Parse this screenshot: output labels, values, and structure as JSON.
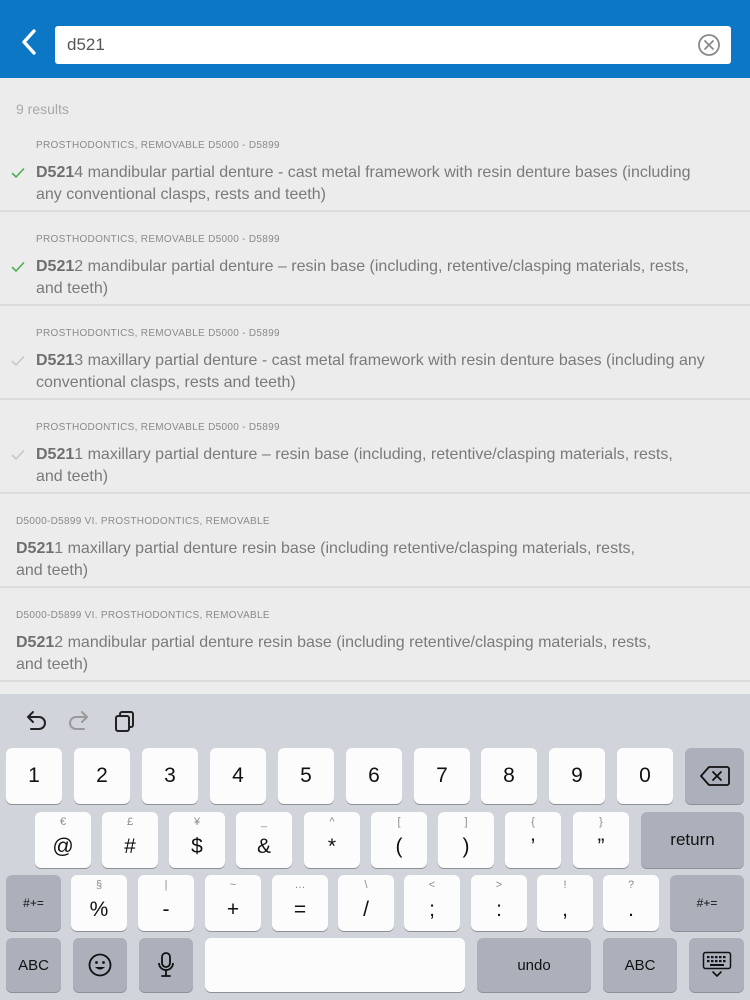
{
  "search": {
    "query": "d521",
    "placeholder": ""
  },
  "results_count": "9 results",
  "results": [
    {
      "category": "PROSTHODONTICS, REMOVABLE D5000 - D5899",
      "code_match": "D521",
      "code_rest": "4",
      "line1": " mandibular partial denture - cast metal framework with resin denture bases (including",
      "line2": "any conventional clasps, rests and teeth)",
      "checked": true,
      "check_color": "#4caf50"
    },
    {
      "category": "PROSTHODONTICS, REMOVABLE D5000 - D5899",
      "code_match": "D521",
      "code_rest": "2",
      "line1": " mandibular partial denture – resin base (including, retentive/clasping materials, rests,",
      "line2": "and teeth)",
      "checked": true,
      "check_color": "#4caf50"
    },
    {
      "category": "PROSTHODONTICS, REMOVABLE D5000 - D5899",
      "code_match": "D521",
      "code_rest": "3",
      "line1": " maxillary partial denture - cast metal framework with resin denture bases (including any",
      "line2": "conventional clasps, rests and teeth)",
      "checked": true,
      "check_color": "#c8c8c8"
    },
    {
      "category": "PROSTHODONTICS, REMOVABLE D5000 - D5899",
      "code_match": "D521",
      "code_rest": "1",
      "line1": " maxillary partial denture – resin base (including, retentive/clasping materials, rests,",
      "line2": "and teeth)",
      "checked": true,
      "check_color": "#c8c8c8"
    },
    {
      "category": "D5000-D5899 VI. PROSTHODONTICS, REMOVABLE",
      "code_match": "D521",
      "code_rest": "1",
      "line1": " maxillary partial denture resin base (including retentive/clasping materials, rests,",
      "line2": "and teeth)",
      "checked": false
    },
    {
      "category": "D5000-D5899 VI. PROSTHODONTICS, REMOVABLE",
      "code_match": "D521",
      "code_rest": "2",
      "line1": " mandibular partial denture resin base (including retentive/clasping materials, rests,",
      "line2": "and teeth)",
      "checked": false
    }
  ],
  "keyboard": {
    "row1": [
      "1",
      "2",
      "3",
      "4",
      "5",
      "6",
      "7",
      "8",
      "9",
      "0"
    ],
    "row2": [
      {
        "hint": "€",
        "main": "@"
      },
      {
        "hint": "£",
        "main": "#"
      },
      {
        "hint": "¥",
        "main": "$"
      },
      {
        "hint": "_",
        "main": "&"
      },
      {
        "hint": "^",
        "main": "*"
      },
      {
        "hint": "[",
        "main": "("
      },
      {
        "hint": "]",
        "main": ")"
      },
      {
        "hint": "{",
        "main": "’"
      },
      {
        "hint": "}",
        "main": "”"
      }
    ],
    "row3": [
      {
        "hint": "§",
        "main": "%"
      },
      {
        "hint": "|",
        "main": "-"
      },
      {
        "hint": "~",
        "main": "+"
      },
      {
        "hint": "…",
        "main": "="
      },
      {
        "hint": "\\",
        "main": "/"
      },
      {
        "hint": "<",
        "main": ";"
      },
      {
        "hint": ">",
        "main": ":"
      },
      {
        "hint": "!",
        "main": ","
      },
      {
        "hint": "?",
        "main": "."
      }
    ],
    "return_label": "return",
    "shift_label": "#+=",
    "abc_label": "ABC",
    "undo_label": "undo"
  },
  "icons": {
    "back": "chevron-left-icon",
    "clear": "clear-circle-icon",
    "check": "checkmark-icon",
    "undo": "undo-arrow-icon",
    "redo": "redo-arrow-icon",
    "paste": "clipboard-icon",
    "delete": "backspace-icon",
    "emoji": "emoji-face-icon",
    "mic": "microphone-icon",
    "hide_keyboard": "keyboard-dismiss-icon"
  },
  "colors": {
    "header": "#0c77c4",
    "background": "#ececec",
    "keyboard": "#d1d4db"
  }
}
